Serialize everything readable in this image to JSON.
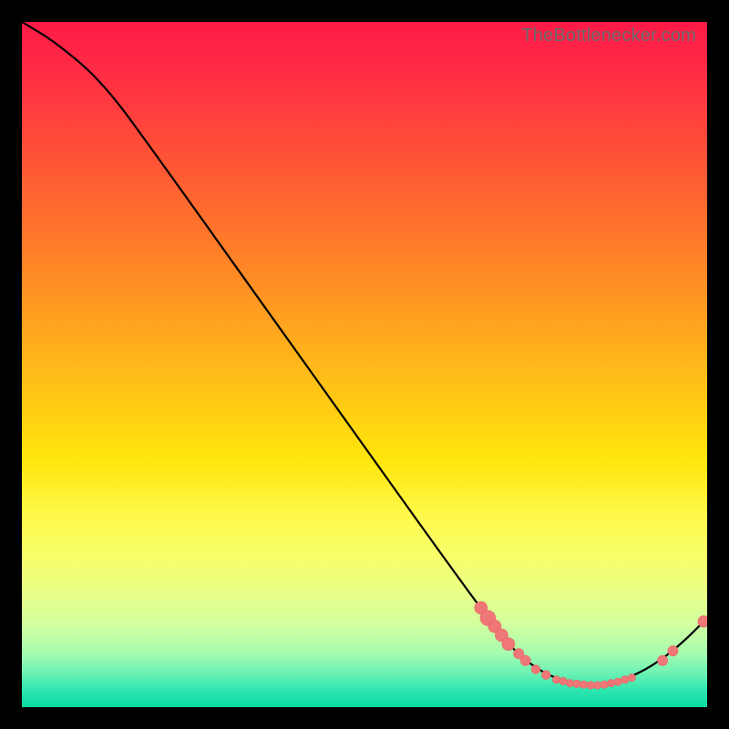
{
  "attribution": "TheBottlenecker.com",
  "colors": {
    "curve": "#000000",
    "marker_fill": "#f07777",
    "marker_stroke": "#e56666",
    "background_black": "#000000"
  },
  "chart_data": {
    "type": "line",
    "title": "",
    "xlabel": "",
    "ylabel": "",
    "xlim": [
      0,
      100
    ],
    "ylim": [
      0,
      100
    ],
    "curve": [
      {
        "x": 0,
        "y": 100
      },
      {
        "x": 5,
        "y": 97
      },
      {
        "x": 12,
        "y": 91
      },
      {
        "x": 20,
        "y": 80
      },
      {
        "x": 30,
        "y": 66
      },
      {
        "x": 40,
        "y": 52
      },
      {
        "x": 50,
        "y": 38
      },
      {
        "x": 60,
        "y": 24
      },
      {
        "x": 68,
        "y": 13
      },
      {
        "x": 72,
        "y": 8
      },
      {
        "x": 76,
        "y": 5
      },
      {
        "x": 80,
        "y": 3.5
      },
      {
        "x": 84,
        "y": 3
      },
      {
        "x": 88,
        "y": 4
      },
      {
        "x": 92,
        "y": 6
      },
      {
        "x": 96,
        "y": 9
      },
      {
        "x": 100,
        "y": 13
      }
    ],
    "markers": [
      {
        "x": 67,
        "y": 14.5,
        "r": 1.0
      },
      {
        "x": 68,
        "y": 13.0,
        "r": 1.2
      },
      {
        "x": 69,
        "y": 11.8,
        "r": 1.0
      },
      {
        "x": 70,
        "y": 10.5,
        "r": 1.0
      },
      {
        "x": 71,
        "y": 9.2,
        "r": 1.0
      },
      {
        "x": 72.5,
        "y": 7.8,
        "r": 0.8
      },
      {
        "x": 73.5,
        "y": 6.8,
        "r": 0.8
      },
      {
        "x": 75,
        "y": 5.5,
        "r": 0.7
      },
      {
        "x": 76.5,
        "y": 4.7,
        "r": 0.7
      },
      {
        "x": 78,
        "y": 4.0,
        "r": 0.6
      },
      {
        "x": 79,
        "y": 3.8,
        "r": 0.6
      },
      {
        "x": 80,
        "y": 3.5,
        "r": 0.6
      },
      {
        "x": 81,
        "y": 3.4,
        "r": 0.6
      },
      {
        "x": 82,
        "y": 3.3,
        "r": 0.6
      },
      {
        "x": 83,
        "y": 3.2,
        "r": 0.6
      },
      {
        "x": 84,
        "y": 3.2,
        "r": 0.6
      },
      {
        "x": 85,
        "y": 3.3,
        "r": 0.6
      },
      {
        "x": 86,
        "y": 3.5,
        "r": 0.6
      },
      {
        "x": 87,
        "y": 3.7,
        "r": 0.6
      },
      {
        "x": 88,
        "y": 4.0,
        "r": 0.6
      },
      {
        "x": 89,
        "y": 4.3,
        "r": 0.6
      },
      {
        "x": 93.5,
        "y": 6.8,
        "r": 0.8
      },
      {
        "x": 95,
        "y": 8.2,
        "r": 0.8
      },
      {
        "x": 99.5,
        "y": 12.5,
        "r": 0.9
      }
    ]
  }
}
